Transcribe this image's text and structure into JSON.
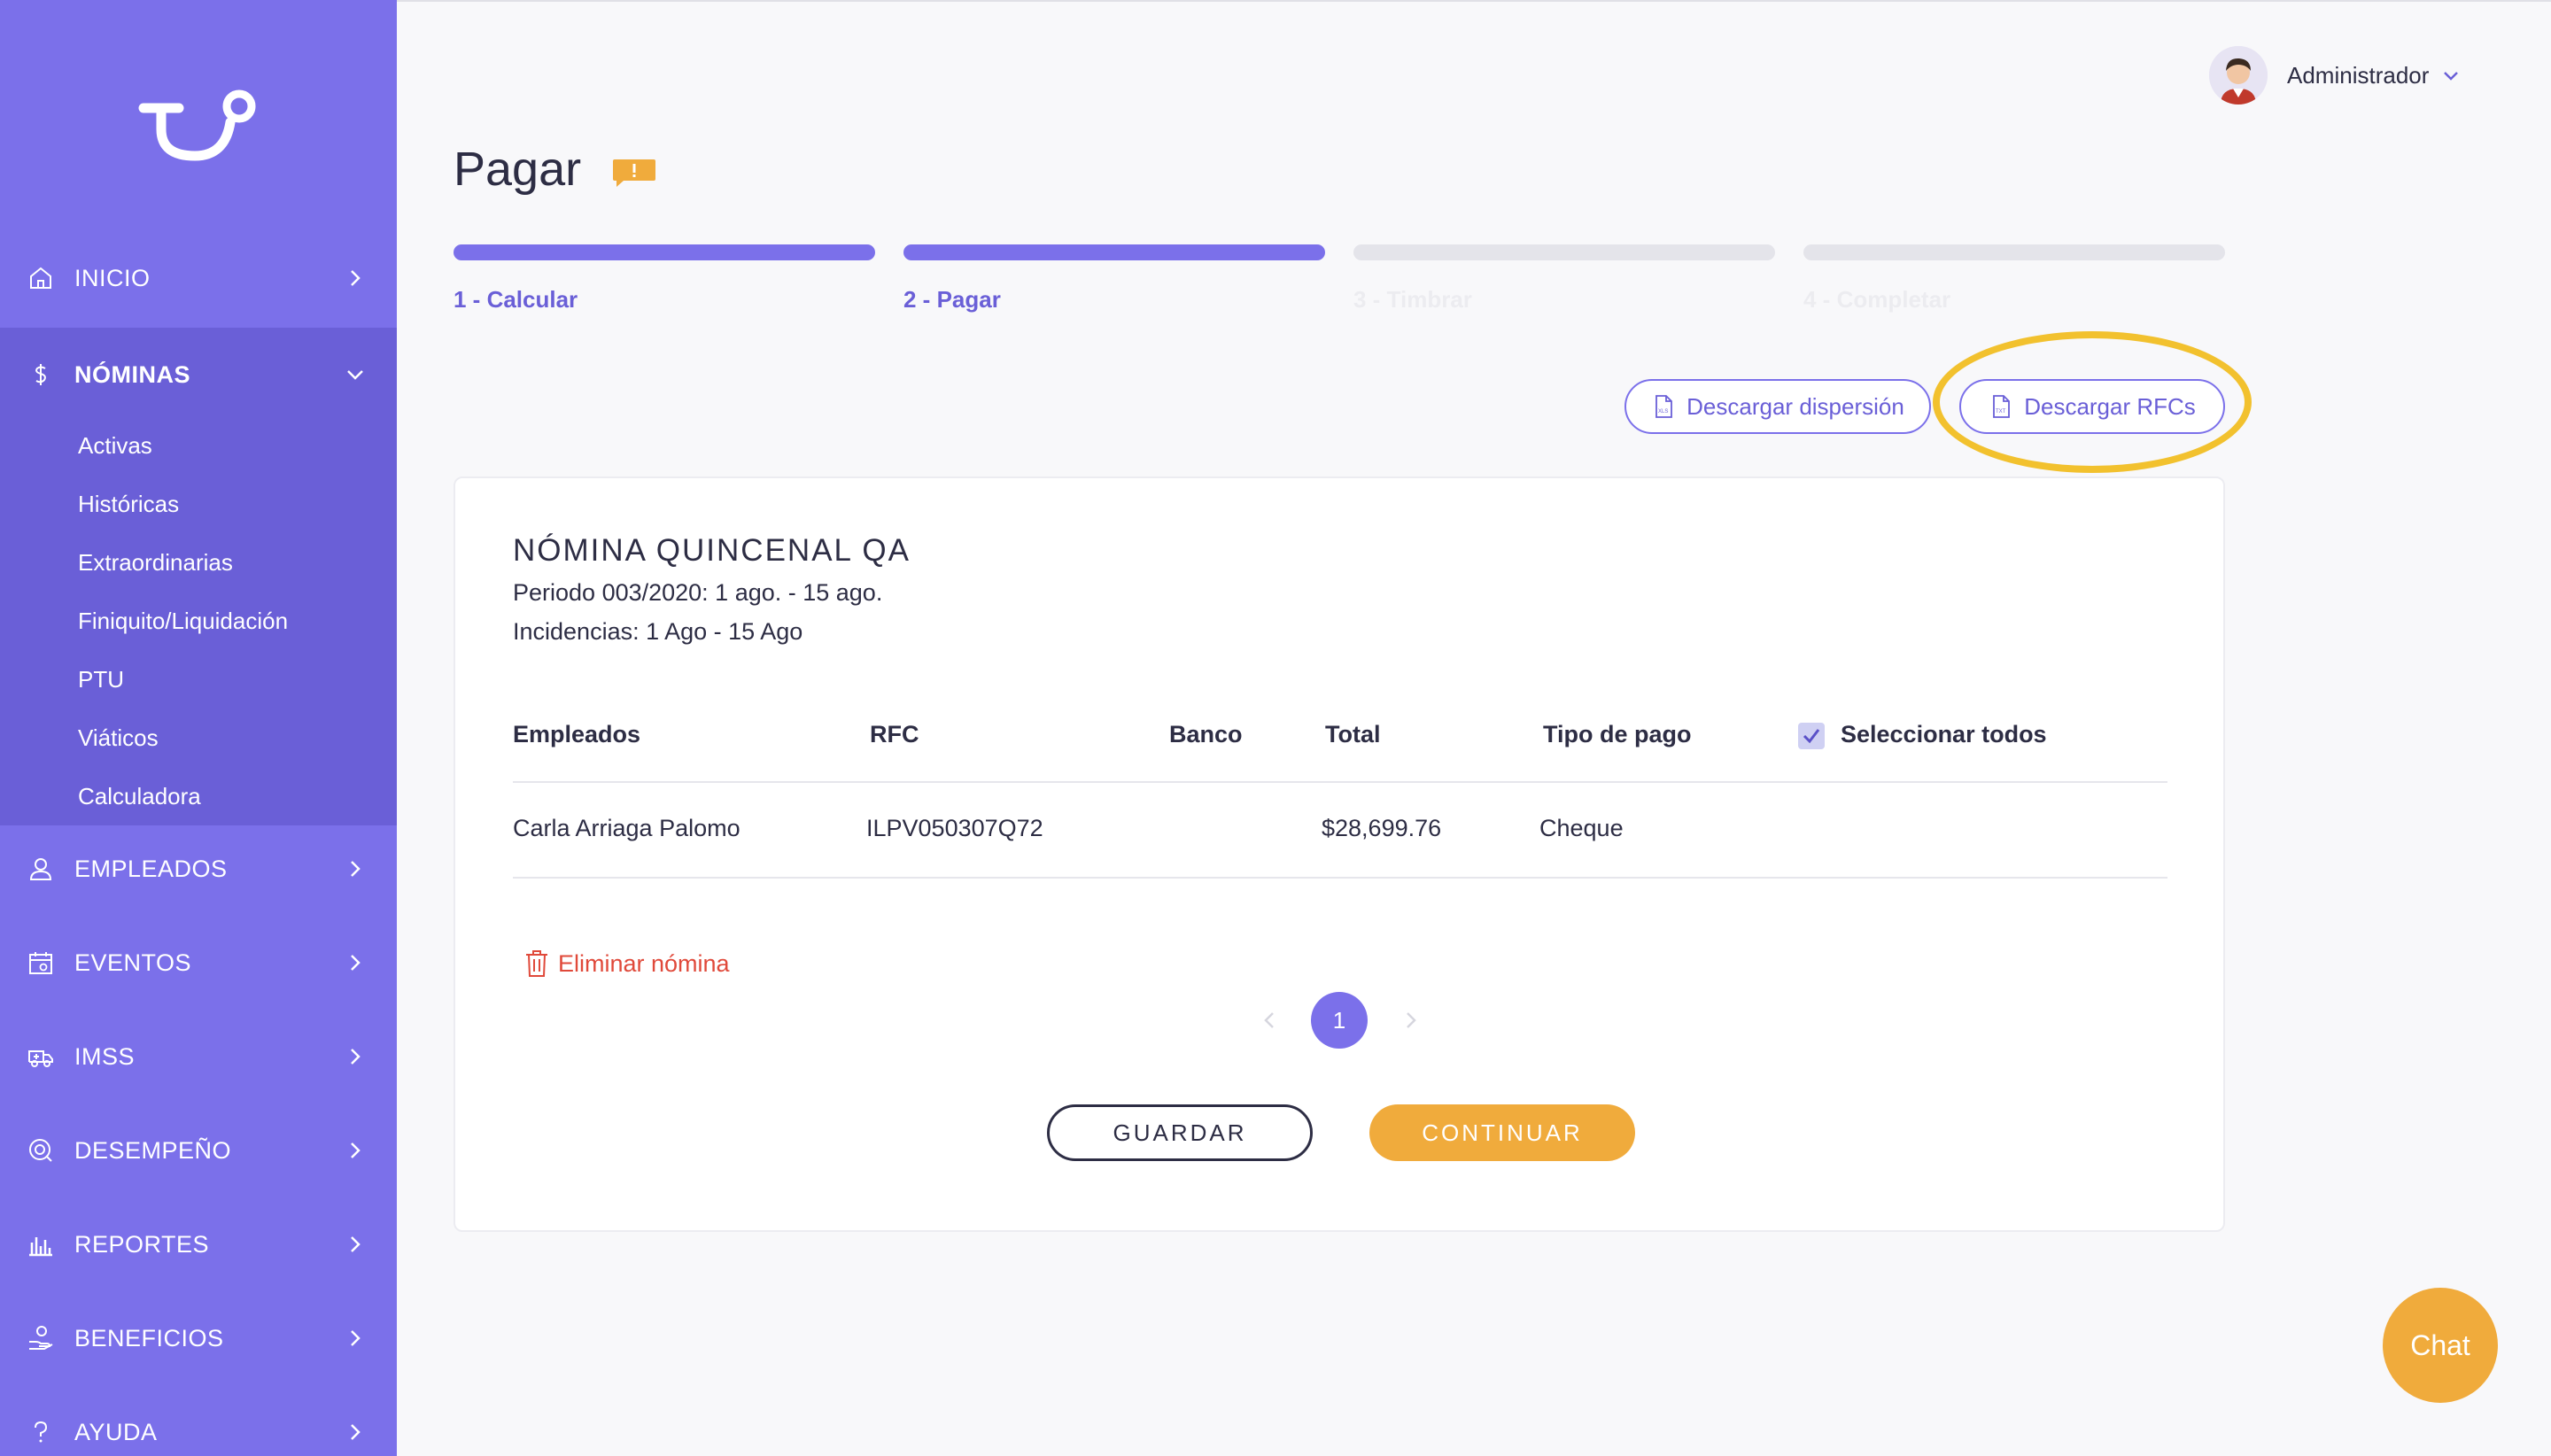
{
  "user": {
    "name": "Administrador"
  },
  "page": {
    "title": "Pagar"
  },
  "steps": [
    {
      "label": "1 - Calcular",
      "status": "done"
    },
    {
      "label": "2 - Pagar",
      "status": "active"
    },
    {
      "label": "3 - Timbrar",
      "status": "pending"
    },
    {
      "label": "4 - Completar",
      "status": "pending"
    }
  ],
  "actions": {
    "download_dispersion": "Descargar dispersión",
    "download_rfcs": "Descargar RFCs"
  },
  "sidebar": {
    "items": [
      {
        "label": "INICIO",
        "icon": "home-icon"
      },
      {
        "label": "NÓMINAS",
        "icon": "dollar-icon"
      },
      {
        "label": "EMPLEADOS",
        "icon": "user-icon"
      },
      {
        "label": "EVENTOS",
        "icon": "calendar-icon"
      },
      {
        "label": "IMSS",
        "icon": "ambulance-icon"
      },
      {
        "label": "DESEMPEÑO",
        "icon": "target-icon"
      },
      {
        "label": "REPORTES",
        "icon": "bar-chart-icon"
      },
      {
        "label": "BENEFICIOS",
        "icon": "hand-gift-icon"
      },
      {
        "label": "AYUDA",
        "icon": "question-icon"
      }
    ],
    "nominas_sub": [
      "Activas",
      "Históricas",
      "Extraordinarias",
      "Finiquito/Liquidación",
      "PTU",
      "Viáticos",
      "Calculadora"
    ]
  },
  "payroll": {
    "title": "NÓMINA QUINCENAL QA",
    "period": "Periodo 003/2020: 1 ago. - 15 ago.",
    "incidences": "Incidencias: 1 Ago - 15 Ago",
    "columns": {
      "employees": "Empleados",
      "rfc": "RFC",
      "bank": "Banco",
      "total": "Total",
      "payment_type": "Tipo de pago",
      "select_all": "Seleccionar todos"
    },
    "rows": [
      {
        "employee": "Carla Arriaga Palomo",
        "rfc": "ILPV050307Q72",
        "bank": "",
        "total": "$28,699.76",
        "payment_type": "Cheque"
      }
    ],
    "delete_label": "Eliminar nómina",
    "current_page": "1",
    "save_label": "GUARDAR",
    "continue_label": "CONTINUAR"
  },
  "chat": {
    "label": "Chat"
  },
  "colors": {
    "primary": "#7b70ea",
    "primary_dark": "#6a5fd7",
    "accent": "#f0ab3c",
    "danger": "#e0493a",
    "highlight": "#f2c12e"
  }
}
